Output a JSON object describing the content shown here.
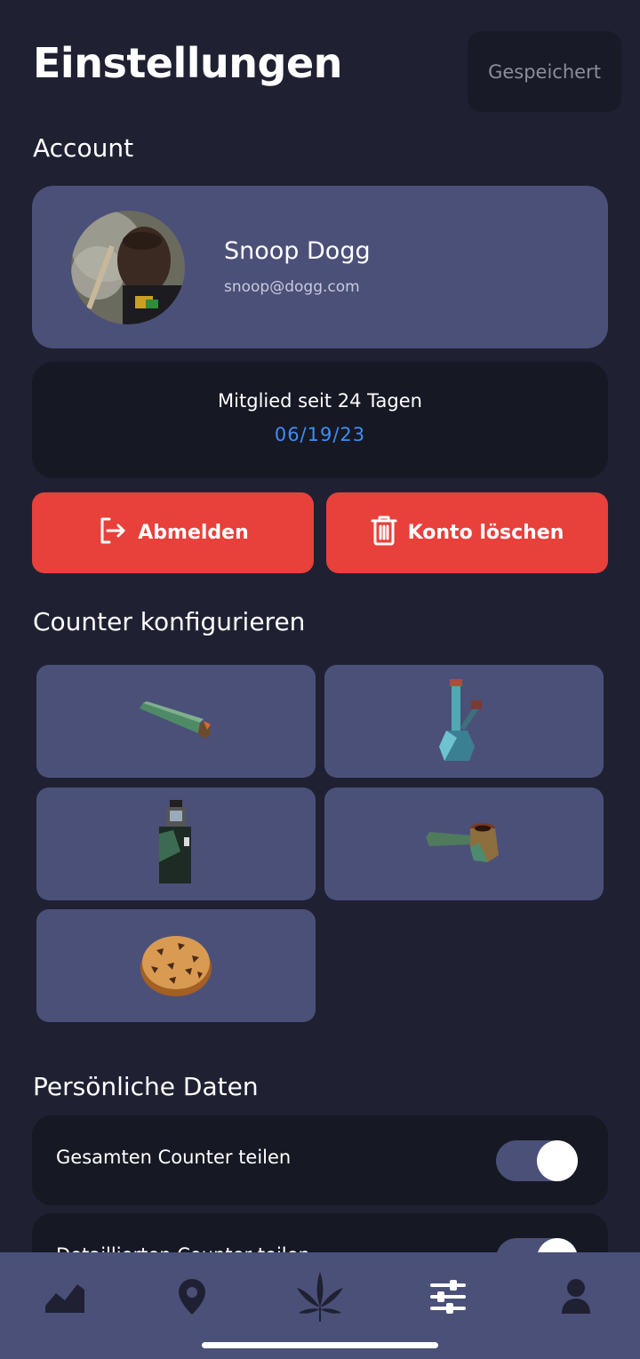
{
  "header": {
    "title": "Einstellungen",
    "saved_label": "Gespeichert"
  },
  "account": {
    "section_title": "Account",
    "name": "Snoop Dogg",
    "email": "snoop@dogg.com",
    "member_text": "Mitglied seit 24 Tagen",
    "member_date": "06/19/23",
    "logout_label": "Abmelden",
    "delete_label": "Konto löschen"
  },
  "counter": {
    "section_title": "Counter konfigurieren",
    "tiles": [
      "joint-icon",
      "bong-icon",
      "vape-icon",
      "pipe-icon",
      "cookie-icon"
    ]
  },
  "personal": {
    "section_title": "Persönliche Daten",
    "toggles": [
      {
        "label": "Gesamten Counter teilen",
        "on": true
      },
      {
        "label": "Detaillierten Counter teilen",
        "on": true
      }
    ]
  },
  "nav": {
    "items": [
      "stats-icon",
      "map-pin-icon",
      "leaf-icon",
      "sliders-icon",
      "user-icon"
    ],
    "active": "sliders-icon"
  },
  "colors": {
    "background": "#1f2133",
    "card": "#4b5079",
    "dark_card": "#161824",
    "danger": "#e8403a",
    "accent": "#3e8ef7"
  }
}
